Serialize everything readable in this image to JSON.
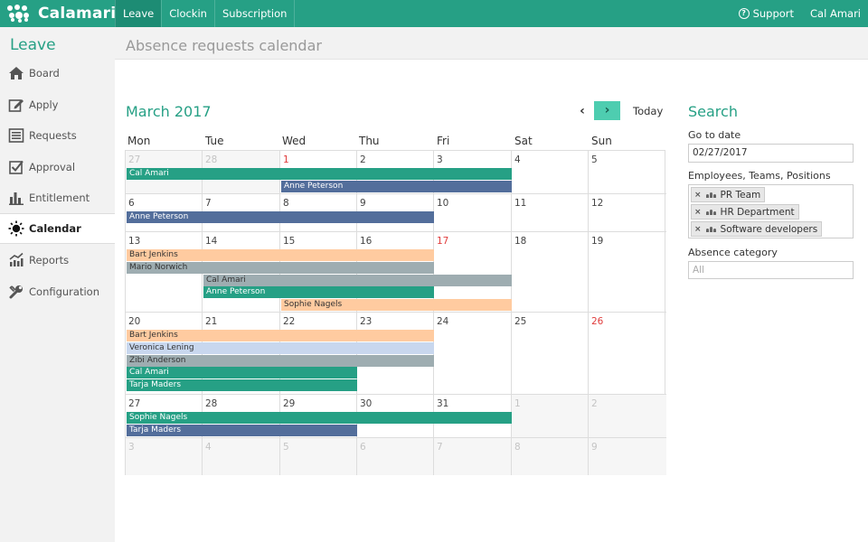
{
  "app": {
    "logo_text": "Calamari"
  },
  "topnav": {
    "tabs": [
      {
        "label": "Leave",
        "active": true
      },
      {
        "label": "Clockin"
      },
      {
        "label": "Subscription"
      }
    ]
  },
  "topright": {
    "support_label": "Support",
    "user_label": "Cal Amari"
  },
  "sidebar": {
    "title": "Leave",
    "items": [
      {
        "label": "Board",
        "icon": "home-icon"
      },
      {
        "label": "Apply",
        "icon": "pencil-icon"
      },
      {
        "label": "Requests",
        "icon": "list-icon"
      },
      {
        "label": "Approval",
        "icon": "checkbox-icon"
      },
      {
        "label": "Entitlement",
        "icon": "bar-chart-icon"
      },
      {
        "label": "Calendar",
        "icon": "sun-icon",
        "active": true
      },
      {
        "label": "Reports",
        "icon": "line-chart-icon"
      },
      {
        "label": "Configuration",
        "icon": "wrench-icon"
      }
    ]
  },
  "page": {
    "title": "Absence requests calendar"
  },
  "calendar": {
    "month_label": "March 2017",
    "prev_label": "‹",
    "next_label": "›",
    "today_label": "Today",
    "weekdays": [
      "Mon",
      "Tue",
      "Wed",
      "Thu",
      "Fri",
      "Sat",
      "Sun"
    ],
    "weeks": [
      [
        "27",
        "28",
        "1",
        "2",
        "3",
        "4",
        "5"
      ],
      [
        "6",
        "7",
        "8",
        "9",
        "10",
        "11",
        "12"
      ],
      [
        "13",
        "14",
        "15",
        "16",
        "17",
        "18",
        "19"
      ],
      [
        "20",
        "21",
        "22",
        "23",
        "24",
        "25",
        "26"
      ],
      [
        "27",
        "28",
        "29",
        "30",
        "31",
        "1",
        "2"
      ],
      [
        "3",
        "4",
        "5",
        "6",
        "7",
        "8",
        "9"
      ]
    ],
    "events": [
      {
        "name": "Cal Amari",
        "start": "2017-02-27",
        "end": "2017-03-03",
        "color": "#26a085"
      },
      {
        "name": "Anne Peterson",
        "start": "2017-03-01",
        "end": "2017-03-03",
        "color": "#536e9b"
      },
      {
        "name": "Anne Peterson",
        "start": "2017-03-06",
        "end": "2017-03-09",
        "color": "#536e9b"
      },
      {
        "name": "Bart Jenkins",
        "start": "2017-03-13",
        "end": "2017-03-16",
        "color": "#ffcba0"
      },
      {
        "name": "Mario Norwich",
        "start": "2017-03-13",
        "end": "2017-03-16",
        "color": "#9eadb1"
      },
      {
        "name": "Cal Amari",
        "start": "2017-03-14",
        "end": "2017-03-17",
        "color": "#9eadb1"
      },
      {
        "name": "Anne Peterson",
        "start": "2017-03-14",
        "end": "2017-03-16",
        "color": "#26a085"
      },
      {
        "name": "Sophie Nagels",
        "start": "2017-03-15",
        "end": "2017-03-17",
        "color": "#ffcba0"
      },
      {
        "name": "Bart Jenkins",
        "start": "2017-03-20",
        "end": "2017-03-23",
        "color": "#ffcba0"
      },
      {
        "name": "Veronica Lening",
        "start": "2017-03-20",
        "end": "2017-03-23",
        "color": "#c8d7ee"
      },
      {
        "name": "Zibi Anderson",
        "start": "2017-03-20",
        "end": "2017-03-23",
        "color": "#9eadb1"
      },
      {
        "name": "Cal Amari",
        "start": "2017-03-20",
        "end": "2017-03-22",
        "color": "#26a085"
      },
      {
        "name": "Tarja Maders",
        "start": "2017-03-20",
        "end": "2017-03-22",
        "color": "#26a085"
      },
      {
        "name": "Sophie Nagels",
        "start": "2017-03-27",
        "end": "2017-03-31",
        "color": "#26a085"
      },
      {
        "name": "Tarja Maders",
        "start": "2017-03-27",
        "end": "2017-03-29",
        "color": "#536e9b"
      }
    ]
  },
  "search": {
    "title": "Search",
    "goto_label": "Go to date",
    "goto_value": "02/27/2017",
    "filter_label": "Employees, Teams, Positions",
    "tags": [
      "PR Team",
      "HR Department",
      "Software developers"
    ],
    "tag_remove_glyph": "×",
    "category_label": "Absence category",
    "category_placeholder": "All"
  }
}
